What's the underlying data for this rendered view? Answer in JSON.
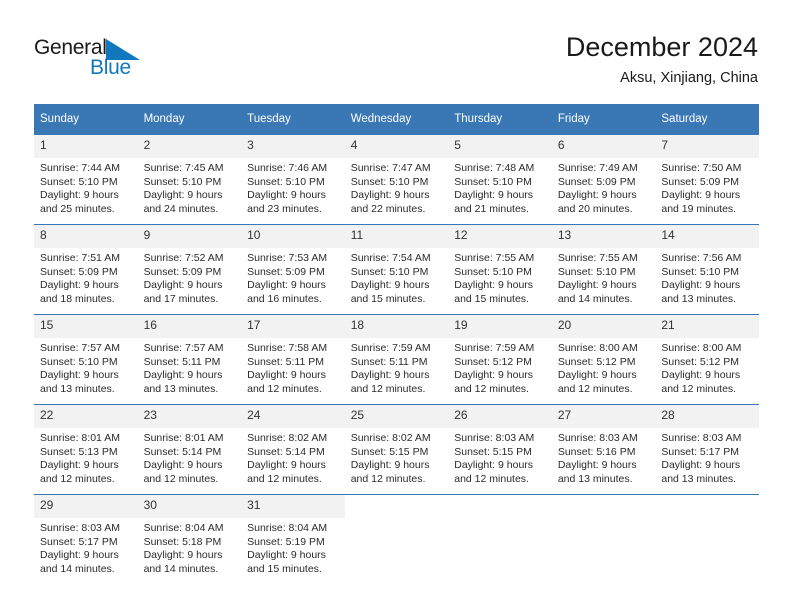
{
  "brand": {
    "name_part1": "General",
    "name_part2": "Blue",
    "mark_icon": "triangle-flag-icon",
    "accent_color": "#1278be"
  },
  "header": {
    "title": "December 2024",
    "subtitle": "Aksu, Xinjiang, China"
  },
  "theme": {
    "header_row_bg": "#3a78b5",
    "daynum_bg": "#f2f2f2",
    "text_color": "#2b2b2b"
  },
  "calendar": {
    "weekday_headers": [
      "Sunday",
      "Monday",
      "Tuesday",
      "Wednesday",
      "Thursday",
      "Friday",
      "Saturday"
    ],
    "weeks": [
      [
        {
          "day": "1",
          "sunrise": "Sunrise: 7:44 AM",
          "sunset": "Sunset: 5:10 PM",
          "daylight_line1": "Daylight: 9 hours",
          "daylight_line2": "and 25 minutes."
        },
        {
          "day": "2",
          "sunrise": "Sunrise: 7:45 AM",
          "sunset": "Sunset: 5:10 PM",
          "daylight_line1": "Daylight: 9 hours",
          "daylight_line2": "and 24 minutes."
        },
        {
          "day": "3",
          "sunrise": "Sunrise: 7:46 AM",
          "sunset": "Sunset: 5:10 PM",
          "daylight_line1": "Daylight: 9 hours",
          "daylight_line2": "and 23 minutes."
        },
        {
          "day": "4",
          "sunrise": "Sunrise: 7:47 AM",
          "sunset": "Sunset: 5:10 PM",
          "daylight_line1": "Daylight: 9 hours",
          "daylight_line2": "and 22 minutes."
        },
        {
          "day": "5",
          "sunrise": "Sunrise: 7:48 AM",
          "sunset": "Sunset: 5:10 PM",
          "daylight_line1": "Daylight: 9 hours",
          "daylight_line2": "and 21 minutes."
        },
        {
          "day": "6",
          "sunrise": "Sunrise: 7:49 AM",
          "sunset": "Sunset: 5:09 PM",
          "daylight_line1": "Daylight: 9 hours",
          "daylight_line2": "and 20 minutes."
        },
        {
          "day": "7",
          "sunrise": "Sunrise: 7:50 AM",
          "sunset": "Sunset: 5:09 PM",
          "daylight_line1": "Daylight: 9 hours",
          "daylight_line2": "and 19 minutes."
        }
      ],
      [
        {
          "day": "8",
          "sunrise": "Sunrise: 7:51 AM",
          "sunset": "Sunset: 5:09 PM",
          "daylight_line1": "Daylight: 9 hours",
          "daylight_line2": "and 18 minutes."
        },
        {
          "day": "9",
          "sunrise": "Sunrise: 7:52 AM",
          "sunset": "Sunset: 5:09 PM",
          "daylight_line1": "Daylight: 9 hours",
          "daylight_line2": "and 17 minutes."
        },
        {
          "day": "10",
          "sunrise": "Sunrise: 7:53 AM",
          "sunset": "Sunset: 5:09 PM",
          "daylight_line1": "Daylight: 9 hours",
          "daylight_line2": "and 16 minutes."
        },
        {
          "day": "11",
          "sunrise": "Sunrise: 7:54 AM",
          "sunset": "Sunset: 5:10 PM",
          "daylight_line1": "Daylight: 9 hours",
          "daylight_line2": "and 15 minutes."
        },
        {
          "day": "12",
          "sunrise": "Sunrise: 7:55 AM",
          "sunset": "Sunset: 5:10 PM",
          "daylight_line1": "Daylight: 9 hours",
          "daylight_line2": "and 15 minutes."
        },
        {
          "day": "13",
          "sunrise": "Sunrise: 7:55 AM",
          "sunset": "Sunset: 5:10 PM",
          "daylight_line1": "Daylight: 9 hours",
          "daylight_line2": "and 14 minutes."
        },
        {
          "day": "14",
          "sunrise": "Sunrise: 7:56 AM",
          "sunset": "Sunset: 5:10 PM",
          "daylight_line1": "Daylight: 9 hours",
          "daylight_line2": "and 13 minutes."
        }
      ],
      [
        {
          "day": "15",
          "sunrise": "Sunrise: 7:57 AM",
          "sunset": "Sunset: 5:10 PM",
          "daylight_line1": "Daylight: 9 hours",
          "daylight_line2": "and 13 minutes."
        },
        {
          "day": "16",
          "sunrise": "Sunrise: 7:57 AM",
          "sunset": "Sunset: 5:11 PM",
          "daylight_line1": "Daylight: 9 hours",
          "daylight_line2": "and 13 minutes."
        },
        {
          "day": "17",
          "sunrise": "Sunrise: 7:58 AM",
          "sunset": "Sunset: 5:11 PM",
          "daylight_line1": "Daylight: 9 hours",
          "daylight_line2": "and 12 minutes."
        },
        {
          "day": "18",
          "sunrise": "Sunrise: 7:59 AM",
          "sunset": "Sunset: 5:11 PM",
          "daylight_line1": "Daylight: 9 hours",
          "daylight_line2": "and 12 minutes."
        },
        {
          "day": "19",
          "sunrise": "Sunrise: 7:59 AM",
          "sunset": "Sunset: 5:12 PM",
          "daylight_line1": "Daylight: 9 hours",
          "daylight_line2": "and 12 minutes."
        },
        {
          "day": "20",
          "sunrise": "Sunrise: 8:00 AM",
          "sunset": "Sunset: 5:12 PM",
          "daylight_line1": "Daylight: 9 hours",
          "daylight_line2": "and 12 minutes."
        },
        {
          "day": "21",
          "sunrise": "Sunrise: 8:00 AM",
          "sunset": "Sunset: 5:12 PM",
          "daylight_line1": "Daylight: 9 hours",
          "daylight_line2": "and 12 minutes."
        }
      ],
      [
        {
          "day": "22",
          "sunrise": "Sunrise: 8:01 AM",
          "sunset": "Sunset: 5:13 PM",
          "daylight_line1": "Daylight: 9 hours",
          "daylight_line2": "and 12 minutes."
        },
        {
          "day": "23",
          "sunrise": "Sunrise: 8:01 AM",
          "sunset": "Sunset: 5:14 PM",
          "daylight_line1": "Daylight: 9 hours",
          "daylight_line2": "and 12 minutes."
        },
        {
          "day": "24",
          "sunrise": "Sunrise: 8:02 AM",
          "sunset": "Sunset: 5:14 PM",
          "daylight_line1": "Daylight: 9 hours",
          "daylight_line2": "and 12 minutes."
        },
        {
          "day": "25",
          "sunrise": "Sunrise: 8:02 AM",
          "sunset": "Sunset: 5:15 PM",
          "daylight_line1": "Daylight: 9 hours",
          "daylight_line2": "and 12 minutes."
        },
        {
          "day": "26",
          "sunrise": "Sunrise: 8:03 AM",
          "sunset": "Sunset: 5:15 PM",
          "daylight_line1": "Daylight: 9 hours",
          "daylight_line2": "and 12 minutes."
        },
        {
          "day": "27",
          "sunrise": "Sunrise: 8:03 AM",
          "sunset": "Sunset: 5:16 PM",
          "daylight_line1": "Daylight: 9 hours",
          "daylight_line2": "and 13 minutes."
        },
        {
          "day": "28",
          "sunrise": "Sunrise: 8:03 AM",
          "sunset": "Sunset: 5:17 PM",
          "daylight_line1": "Daylight: 9 hours",
          "daylight_line2": "and 13 minutes."
        }
      ],
      [
        {
          "day": "29",
          "sunrise": "Sunrise: 8:03 AM",
          "sunset": "Sunset: 5:17 PM",
          "daylight_line1": "Daylight: 9 hours",
          "daylight_line2": "and 14 minutes."
        },
        {
          "day": "30",
          "sunrise": "Sunrise: 8:04 AM",
          "sunset": "Sunset: 5:18 PM",
          "daylight_line1": "Daylight: 9 hours",
          "daylight_line2": "and 14 minutes."
        },
        {
          "day": "31",
          "sunrise": "Sunrise: 8:04 AM",
          "sunset": "Sunset: 5:19 PM",
          "daylight_line1": "Daylight: 9 hours",
          "daylight_line2": "and 15 minutes."
        },
        {
          "day": "",
          "sunrise": "",
          "sunset": "",
          "daylight_line1": "",
          "daylight_line2": ""
        },
        {
          "day": "",
          "sunrise": "",
          "sunset": "",
          "daylight_line1": "",
          "daylight_line2": ""
        },
        {
          "day": "",
          "sunrise": "",
          "sunset": "",
          "daylight_line1": "",
          "daylight_line2": ""
        },
        {
          "day": "",
          "sunrise": "",
          "sunset": "",
          "daylight_line1": "",
          "daylight_line2": ""
        }
      ]
    ]
  }
}
